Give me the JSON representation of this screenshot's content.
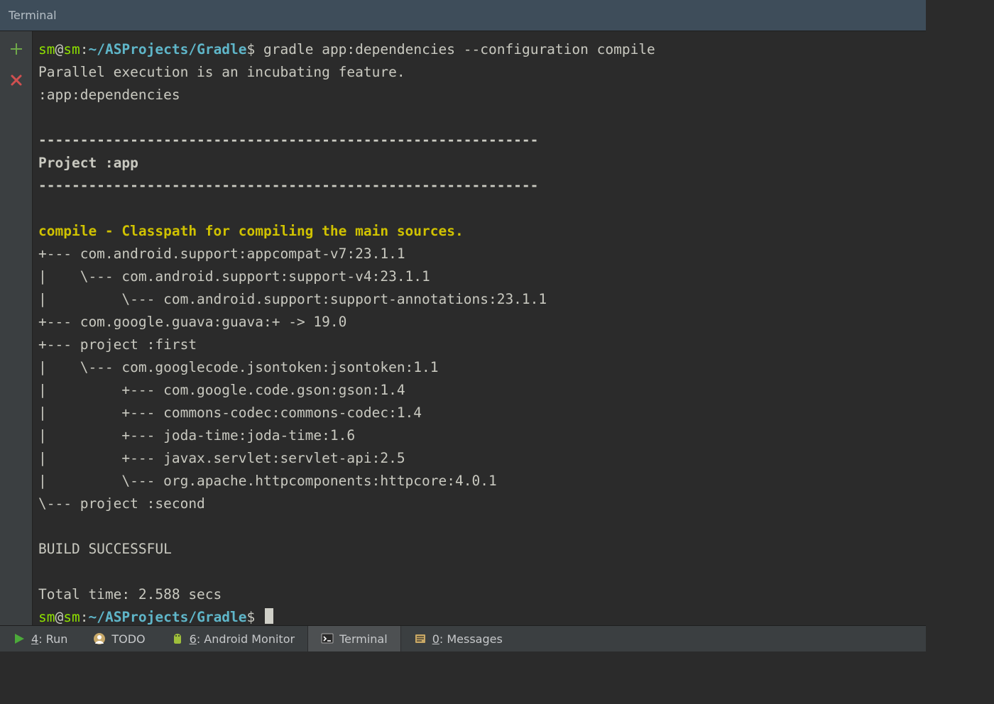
{
  "titlebar": {
    "title": "Terminal"
  },
  "prompt1": {
    "user": "sm",
    "at": "@",
    "host": "sm",
    "colon": ":",
    "path": "~/ASProjects/Gradle",
    "dollar": "$",
    "command": " gradle app:dependencies --configuration compile"
  },
  "output": {
    "l1": "Parallel execution is an incubating feature.",
    "l2": ":app:dependencies",
    "l3": "",
    "sep": "------------------------------------------------------------",
    "l5": "Project :app",
    "l7": "",
    "compile_hdr": "compile - Classpath for compiling the main sources.",
    "t1": "+--- com.android.support:appcompat-v7:23.1.1",
    "t2": "|    \\--- com.android.support:support-v4:23.1.1",
    "t3": "|         \\--- com.android.support:support-annotations:23.1.1",
    "t4": "+--- com.google.guava:guava:+ -> 19.0",
    "t5": "+--- project :first",
    "t6": "|    \\--- com.googlecode.jsontoken:jsontoken:1.1",
    "t7": "|         +--- com.google.code.gson:gson:1.4",
    "t8": "|         +--- commons-codec:commons-codec:1.4",
    "t9": "|         +--- joda-time:joda-time:1.6",
    "t10": "|         +--- javax.servlet:servlet-api:2.5",
    "t11": "|         \\--- org.apache.httpcomponents:httpcore:4.0.1",
    "t12": "\\--- project :second",
    "l_blank2": "",
    "build": "BUILD SUCCESSFUL",
    "l_blank3": "",
    "time": "Total time: 2.588 secs"
  },
  "prompt2": {
    "user": "sm",
    "at": "@",
    "host": "sm",
    "colon": ":",
    "path": "~/ASProjects/Gradle",
    "dollar": "$"
  },
  "bottombar": {
    "run": {
      "num": "4",
      "label": ": Run"
    },
    "todo": {
      "label": "TODO"
    },
    "android": {
      "num": "6",
      "label": ": Android Monitor"
    },
    "terminal": {
      "label": "Terminal"
    },
    "messages": {
      "num": "0",
      "label": ": Messages"
    }
  }
}
